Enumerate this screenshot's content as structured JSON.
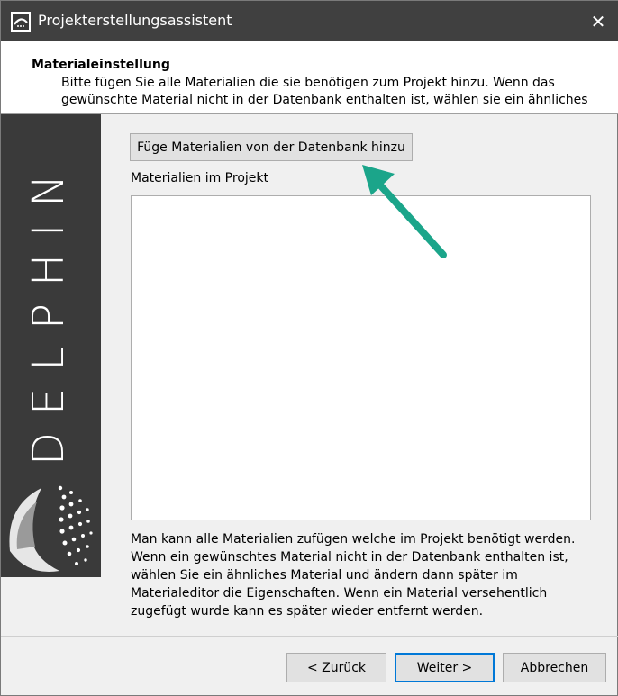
{
  "window": {
    "title": "Projekterstellungsassistent",
    "close_glyph": "✕"
  },
  "header": {
    "title": "Materialeinstellung",
    "subtitle": "Bitte fügen Sie alle Materialien die sie benötigen zum Projekt hinzu. Wenn das gewünschte Material nicht in der Datenbank enthalten ist, wählen sie ein ähnliches"
  },
  "sidebar": {
    "brand": "DELPHIN"
  },
  "main": {
    "add_button_label": "Füge Materialien von der Datenbank hinzu",
    "list_label": "Materialien im Projekt",
    "info_text": "Man kann alle Materialien zufügen welche im Projekt benötigt werden. Wenn ein gewünschtes Material nicht in der Datenbank enthalten ist, wählen Sie ein ähnliches Material und ändern dann später im Materialeditor die Eigenschaften. Wenn ein Material versehentlich zugefügt wurde kann es später wieder entfernt werden."
  },
  "footer": {
    "back_label": "< Zurück",
    "next_label": "Weiter >",
    "cancel_label": "Abbrechen"
  },
  "colors": {
    "titlebar": "#404040",
    "sidebar": "#3a3a3a",
    "annotation_arrow": "#1ba58a",
    "focus": "#0078d7"
  },
  "icons": {
    "app": "delphin-app-icon",
    "close": "close-icon",
    "annotation": "arrow-annotation-icon"
  }
}
